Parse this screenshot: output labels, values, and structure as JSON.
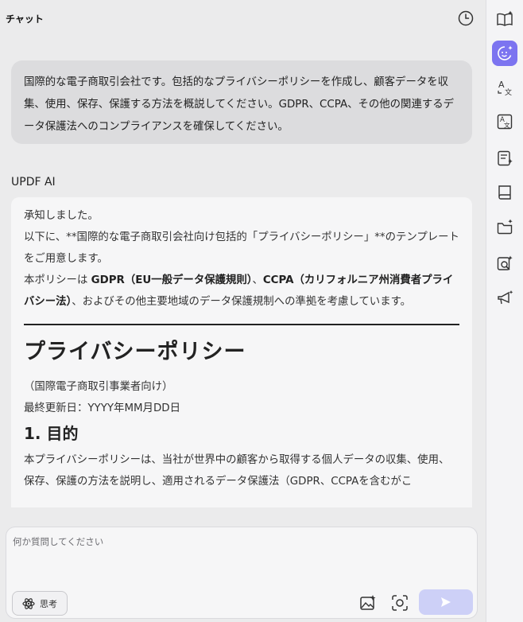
{
  "header": {
    "title": "チャット"
  },
  "user_message": "国際的な電子商取引会社です。包括的なプライバシーポリシーを作成し、顧客データを収集、使用、保存、保護する方法を概説してください。GDPR、CCPA、その他の関連するデータ保護法へのコンプライアンスを確保してください。",
  "ai_label": "UPDF AI",
  "answer": {
    "line1": "承知しました。",
    "line2": "以下に、**国際的な電子商取引会社向け包括的「プライバシーポリシー」**のテンプレートをご用意します。",
    "line3_prefix": "本ポリシーは ",
    "line3_bold1": "GDPR（EU一般データ保護規則）",
    "line3_mid": "、",
    "line3_bold2": "CCPA（カリフォルニア州消費者プライバシー法）",
    "line3_suffix": "、およびその他主要地域のデータ保護規制への準拠を考慮しています。",
    "doc_title": "プライバシーポリシー",
    "doc_subtitle": "（国際電子商取引事業者向け）",
    "doc_updated": "最終更新日：YYYY年MM月DD日",
    "section1_title": "1. 目的",
    "section1_text": "本プライバシーポリシーは、当社が世界中の顧客から取得する個人データの収集、使用、保存、保護の方法を説明し、適用されるデータ保護法（GDPR、CCPAを含むがこ"
  },
  "input": {
    "placeholder": "何か質問してください",
    "value": ""
  },
  "think_label": "思考",
  "icons": {
    "history": "history-clock-icon",
    "think": "atom-icon",
    "image_add": "image-sparkle-icon",
    "screenshot": "camera-icon",
    "send": "send-icon"
  },
  "sidebar": [
    {
      "name": "book-sparkle-icon",
      "active": false
    },
    {
      "name": "ai-chat-icon",
      "active": true
    },
    {
      "name": "translate-icon",
      "active": false
    },
    {
      "name": "translate-doc-icon",
      "active": false
    },
    {
      "name": "summarize-icon",
      "active": false
    },
    {
      "name": "knowledge-book-icon",
      "active": false
    },
    {
      "name": "folder-sparkle-icon",
      "active": false
    },
    {
      "name": "search-sparkle-icon",
      "active": false
    },
    {
      "name": "announce-icon",
      "active": false
    }
  ],
  "colors": {
    "accent": "#7c74f0",
    "send_bg": "#cdd0f7",
    "bubble": "#dcdcde"
  }
}
